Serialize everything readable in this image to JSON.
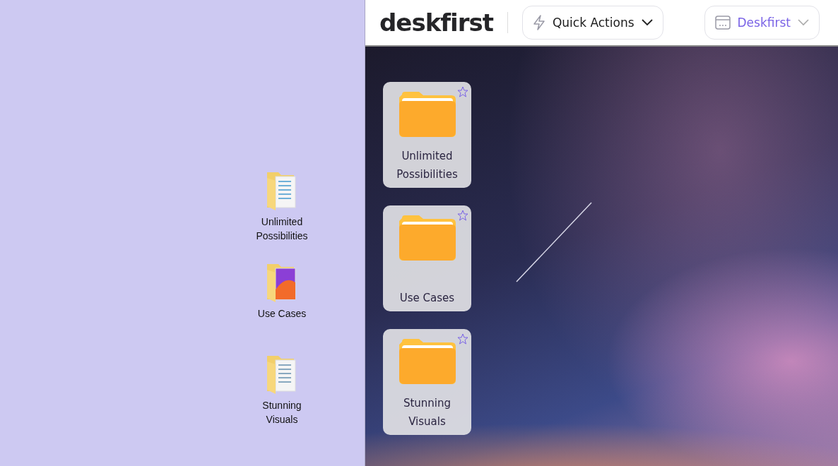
{
  "desktop_icons": [
    {
      "label": "Unlimited Possibilities"
    },
    {
      "label": "Use Cases"
    },
    {
      "label": "Stunning Visuals"
    }
  ],
  "header": {
    "logo": "deskfirst",
    "quick_actions": {
      "label": "Quick Actions"
    },
    "workspace": {
      "label": "Deskfirst"
    }
  },
  "folders": [
    {
      "label": "Unlimited Possibilities",
      "starred": false
    },
    {
      "label": "Use Cases",
      "starred": false
    },
    {
      "label": "Stunning Visuals",
      "starred": false
    }
  ]
}
